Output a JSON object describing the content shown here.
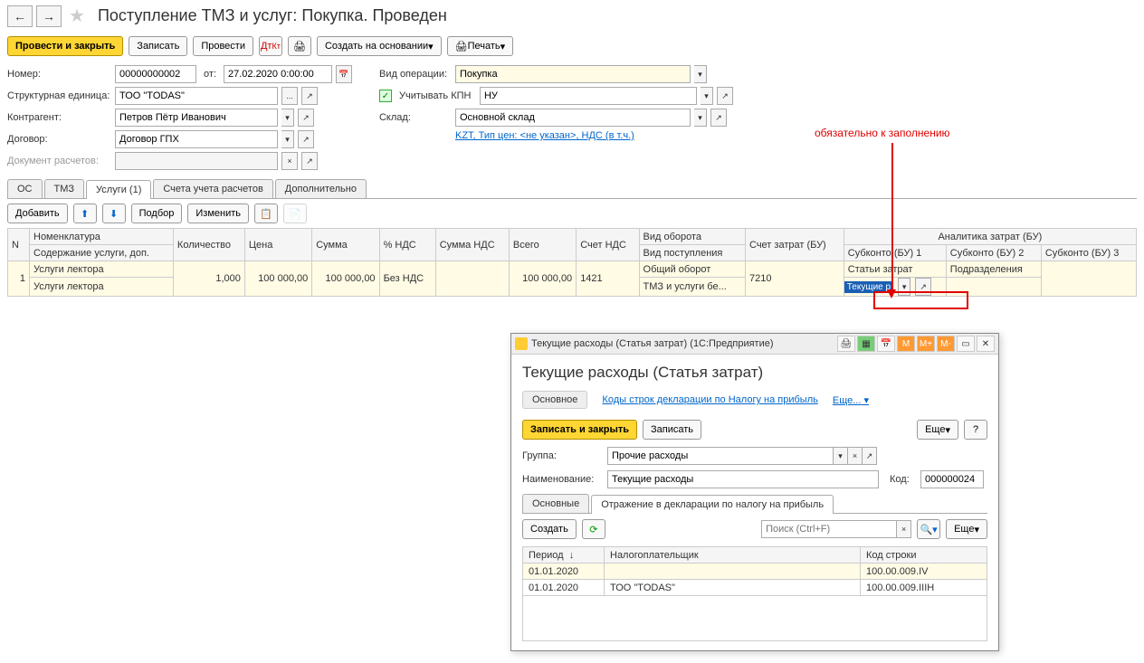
{
  "page_title": "Поступление ТМЗ и услуг: Покупка. Проведен",
  "toolbar": {
    "post_close": "Провести и закрыть",
    "save": "Записать",
    "post": "Провести",
    "create_based": "Создать на основании",
    "print": "Печать"
  },
  "header": {
    "number_label": "Номер:",
    "number": "00000000002",
    "from_label": "от:",
    "date": "27.02.2020 0:00:00",
    "org_label": "Структурная единица:",
    "org": "ТОО \"TODAS\"",
    "counterparty_label": "Контрагент:",
    "counterparty": "Петров Пётр Иванович",
    "contract_label": "Договор:",
    "contract": "Договор ГПХ",
    "doc_calc_label": "Документ расчетов:",
    "doc_calc": "",
    "op_type_label": "Вид операции:",
    "op_type": "Покупка",
    "kpn_label": "Учитывать КПН",
    "kpn_val": "НУ",
    "warehouse_label": "Склад:",
    "warehouse": "Основной склад",
    "price_info": "KZT, Тип цен: <не указан>, НДС (в т.ч.)"
  },
  "tabs": {
    "os": "ОС",
    "tmz": "ТМЗ",
    "services": "Услуги (1)",
    "accounts": "Счета учета расчетов",
    "extra": "Дополнительно"
  },
  "tab_toolbar": {
    "add": "Добавить",
    "select": "Подбор",
    "edit": "Изменить"
  },
  "grid_headers": {
    "n": "N",
    "nomenclature": "Номенклатура",
    "desc": "Содержание услуги, доп.",
    "qty": "Количество",
    "price": "Цена",
    "sum": "Сумма",
    "vat_pct": "% НДС",
    "vat_sum": "Сумма НДС",
    "total": "Всего",
    "vat_acc": "Счет НДС",
    "turnover_type": "Вид оборота",
    "receipt_type": "Вид поступления",
    "cost_acc": "Счет затрат (БУ)",
    "analytics": "Аналитика затрат (БУ)",
    "sub1": "Субконто (БУ) 1",
    "sub2": "Субконто (БУ) 2",
    "sub3": "Субконто (БУ) 3"
  },
  "grid_row": {
    "n": "1",
    "nomenclature": "Услуги лектора",
    "desc": "Услуги лектора",
    "qty": "1,000",
    "price": "100 000,00",
    "sum": "100 000,00",
    "vat_pct": "Без НДС",
    "vat_sum": "",
    "total": "100 000,00",
    "vat_acc": "1421",
    "turnover": "Общий оборот",
    "receipt": "ТМЗ и услуги бе...",
    "cost_acc": "7210",
    "sub1_a": "Статьи затрат",
    "sub1_b": "Текущие р",
    "sub2_a": "Подразделения"
  },
  "annotation": "обязательно к заполнению",
  "popup": {
    "titlebar": "Текущие расходы (Статья затрат)  (1С:Предприятие)",
    "title": "Текущие расходы (Статья затрат)",
    "link_main": "Основное",
    "link_codes": "Коды строк декларации по Налогу на прибыль",
    "link_more": "Еще...",
    "btn_save_close": "Записать и закрыть",
    "btn_save": "Записать",
    "btn_more": "Еще",
    "group_label": "Группа:",
    "group": "Прочие расходы",
    "name_label": "Наименование:",
    "name": "Текущие расходы",
    "code_label": "Код:",
    "code": "000000024",
    "tab_main": "Основные",
    "tab_decl": "Отражение в декларации по налогу на прибыль",
    "btn_create": "Создать",
    "search_ph": "Поиск (Ctrl+F)",
    "col_period": "Период",
    "col_taxpayer": "Налогоплательщик",
    "col_code": "Код строки",
    "rows": [
      {
        "period": "01.01.2020",
        "taxpayer": "",
        "code": "100.00.009.IV"
      },
      {
        "period": "01.01.2020",
        "taxpayer": "ТОО \"TODAS\"",
        "code": "100.00.009.IIIH"
      }
    ],
    "mbtns": [
      "M",
      "M+",
      "M-"
    ]
  }
}
